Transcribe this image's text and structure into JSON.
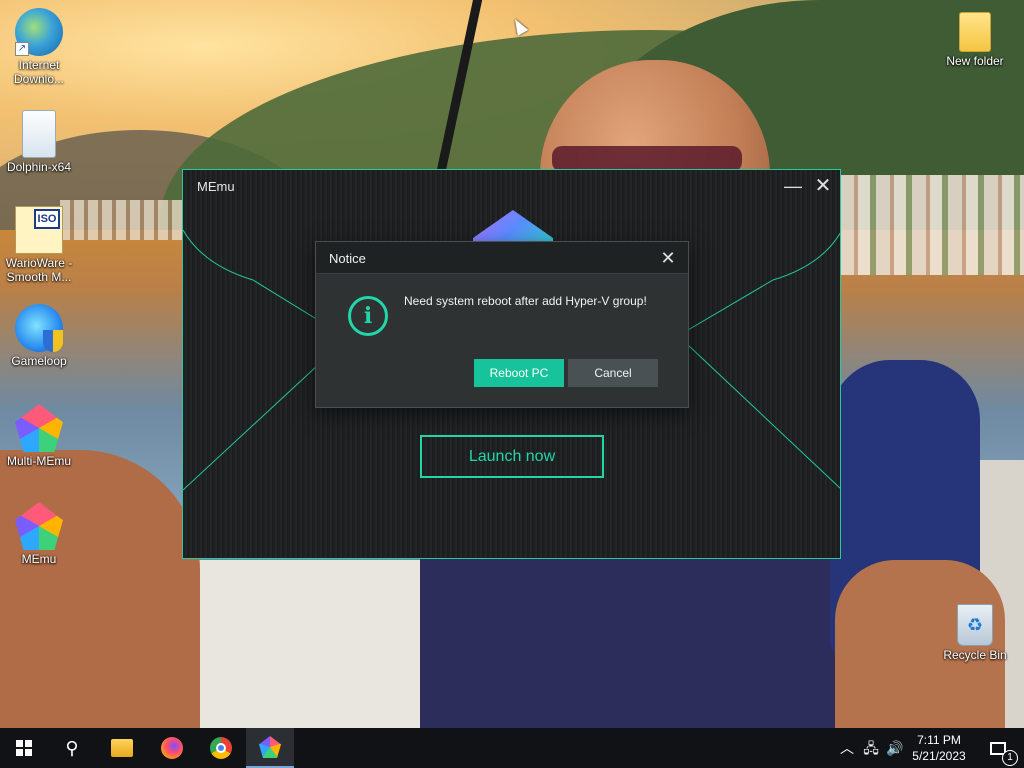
{
  "desktop": {
    "icons": [
      {
        "label": "Internet Downlo...",
        "icon": "idm-icon"
      },
      {
        "label": "Dolphin-x64",
        "icon": "dolphin-icon"
      },
      {
        "label": "WarioWare - Smooth M...",
        "icon": "iso-file-icon",
        "badge": "ISO"
      },
      {
        "label": "Gameloop",
        "icon": "gameloop-icon"
      },
      {
        "label": "Multi-MEmu",
        "icon": "multi-memu-icon"
      },
      {
        "label": "MEmu",
        "icon": "memu-icon"
      },
      {
        "label": "New folder",
        "icon": "folder-icon"
      },
      {
        "label": "Recycle Bin",
        "icon": "recycle-bin-icon"
      }
    ]
  },
  "memu_window": {
    "title": "MEmu",
    "minimize_glyph": "—",
    "close_glyph": "✕",
    "launch_label": "Launch now",
    "accent": "#22d6a8"
  },
  "notice_dialog": {
    "title": "Notice",
    "close_glyph": "✕",
    "info_glyph": "i",
    "message": "Need system reboot after add Hyper-V group!",
    "reboot_label": "Reboot PC",
    "cancel_label": "Cancel",
    "reboot_color": "#17c39a"
  },
  "taskbar": {
    "search_glyph": "⚲",
    "pinned": [
      "file-explorer-icon",
      "firefox-icon",
      "chrome-icon",
      "memu-icon"
    ],
    "active_app": "MEmu",
    "tray_chevron": "︿",
    "network_glyph": "🖧",
    "volume_glyph": "🔊",
    "time": "7:11 PM",
    "date": "5/21/2023",
    "notification_count": "1"
  }
}
